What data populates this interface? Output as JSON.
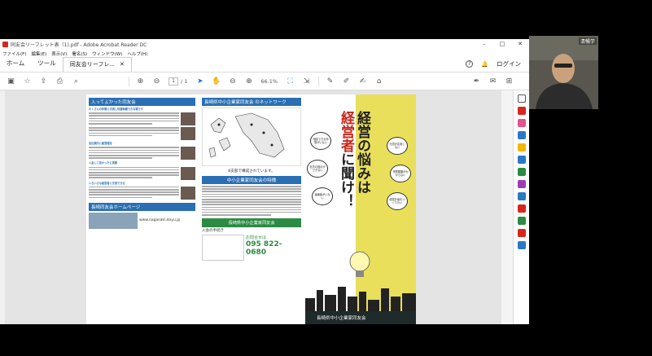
{
  "window": {
    "title": "同友会リーフレット表（1).pdf - Adobe Acrobat Reader DC",
    "min": "–",
    "max": "□",
    "close": "✕"
  },
  "menu": [
    "ファイル(F)",
    "編集(E)",
    "表示(V)",
    "署名(S)",
    "ウィンドウ(W)",
    "ヘルプ(H)"
  ],
  "tabs": {
    "home": "ホーム",
    "tools": "ツール",
    "doc": "同友会リーフレ...",
    "doc_close": "✕",
    "help": "?",
    "bell": "🔔",
    "login": "ログイン"
  },
  "toolbar": {
    "page_current": "1",
    "page_total": "/ 1",
    "zoom": "66.1%"
  },
  "leaflet": {
    "sec1": "入ってよかった同友会",
    "sec1_sub": "たくさんの仲間と交流し切磋琢磨できる場です",
    "sec2": "会社案内と経営理念",
    "sec3": "入会して良かったと実感",
    "sec4": "いろいろな経営者と交流できる",
    "homepage": "長崎同友会ホームページ",
    "url": "www.nagasaki.doyu.jp",
    "net_head": "長崎県中小企業家同友会 のネットワーク",
    "map_caption": "8支部で構成されています。",
    "feature_head": "中小企業家同友会の特徴",
    "logo": "長崎県中小企業家同友会",
    "join": "入会の手続き",
    "contact_label": "お問合せは",
    "tel": "095 822-0680",
    "title_a": "経営の悩みは",
    "title_b": "経営者",
    "title_c": "に聞け！",
    "b1": "相談できる仲間がいない",
    "b2": "社内の指示ができない",
    "b3": "後継者がいない",
    "b4": "社員が定着しない",
    "b5": "事業展開がわからない",
    "b6": "経営計画をつくりたい",
    "footer": "長崎県中小企業家同友会"
  },
  "webcam": {
    "name": "清暢学"
  },
  "colors": {
    "blue": "#2a6fb3",
    "green": "#2c8b43",
    "yellow": "#e9df5b",
    "red": "#c8261b"
  }
}
